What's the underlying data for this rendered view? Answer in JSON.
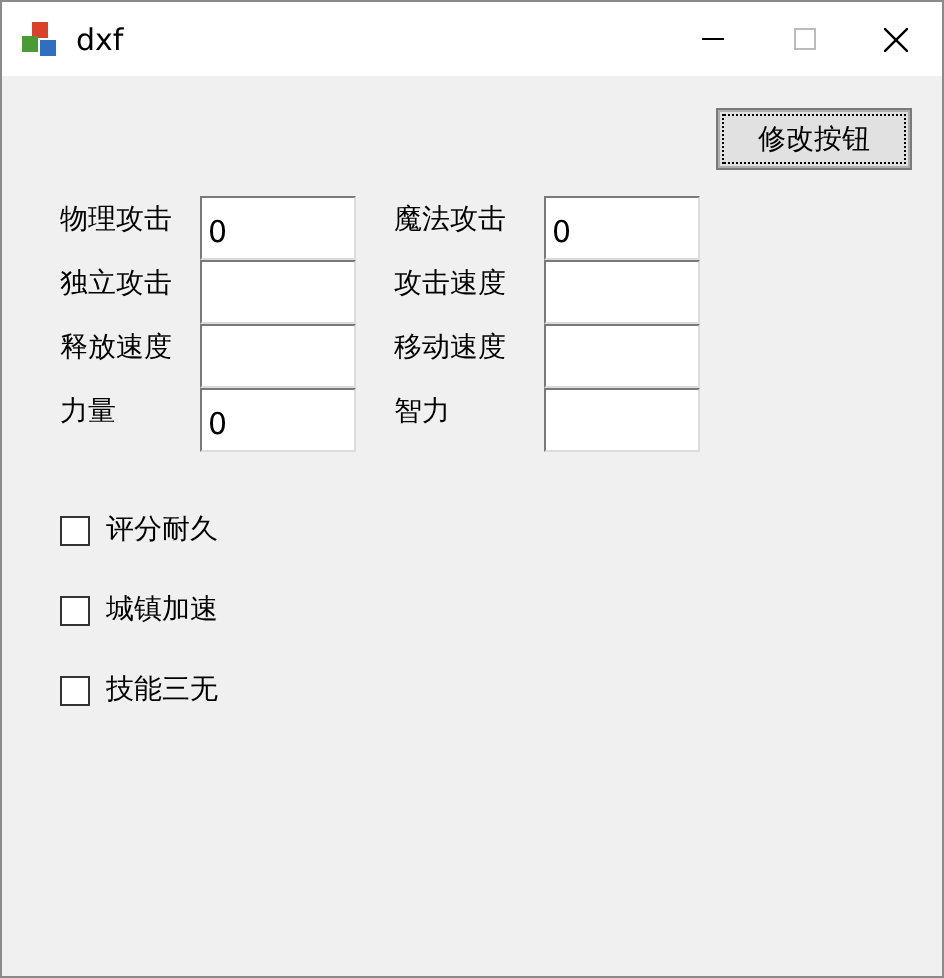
{
  "window": {
    "title": "dxf"
  },
  "button": "修改按钮",
  "fields": [
    {
      "label": "物理攻击",
      "value": "0"
    },
    {
      "label": "魔法攻击",
      "value": "0"
    },
    {
      "label": "独立攻击"
    },
    {
      "label": "攻击速度"
    },
    {
      "label": "释放速度"
    },
    {
      "label": "移动速度"
    },
    {
      "label": "力量",
      "value": "0"
    },
    {
      "label": "智力"
    }
  ],
  "checkboxes": [
    {
      "label": "评分耐久",
      "checked": false
    },
    {
      "label": "城镇加速",
      "checked": false
    },
    {
      "label": "技能三无",
      "checked": false
    }
  ]
}
